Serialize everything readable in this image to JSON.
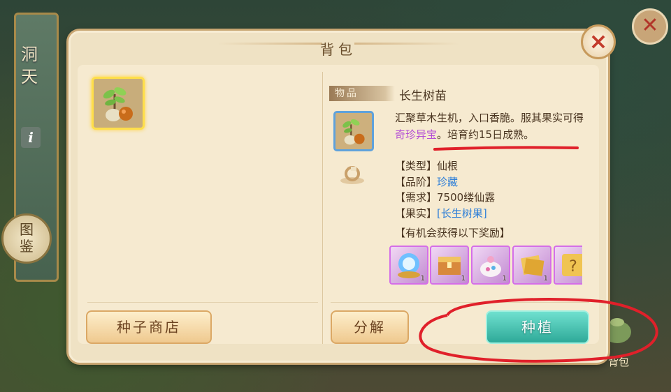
{
  "background": {
    "side_text_1": "洞",
    "side_text_2": "天",
    "info_label": "i",
    "tujian_1": "图",
    "tujian_2": "鉴",
    "bag_label": "背包"
  },
  "dialog": {
    "title": "背包",
    "close_icon": "×"
  },
  "inventory": {
    "selected_item": "长生树苗"
  },
  "detail": {
    "tag": "物品",
    "name": "长生树苗",
    "desc_part1": "汇聚草木生机，入口香脆。服其果实可得",
    "desc_highlight": "奇珍异宝",
    "desc_part2": "。培育约15日成熟。",
    "type_label": "【类型】",
    "type_value": "仙根",
    "grade_label": "【品阶】",
    "grade_value": "珍藏",
    "need_label": "【需求】",
    "need_value": "7500缕仙露",
    "fruit_label": "【果实】",
    "fruit_value": "[长生树果]",
    "reward_title": "【有机会获得以下奖励】",
    "rewards": [
      {
        "icon": "orb-icon",
        "count": "1"
      },
      {
        "icon": "chest-icon",
        "count": "1"
      },
      {
        "icon": "teapot-icon",
        "count": "1"
      },
      {
        "icon": "scroll-icon",
        "count": "1"
      },
      {
        "icon": "mystery-icon",
        "count": ""
      }
    ]
  },
  "buttons": {
    "shop": "种子商店",
    "decompose": "分解",
    "plant": "种植"
  },
  "colors": {
    "highlight_purple": "#b34cd6",
    "grade_blue": "#2e7fd8",
    "plant_button": "#2ea998",
    "annotation_red": "#e0202a"
  }
}
